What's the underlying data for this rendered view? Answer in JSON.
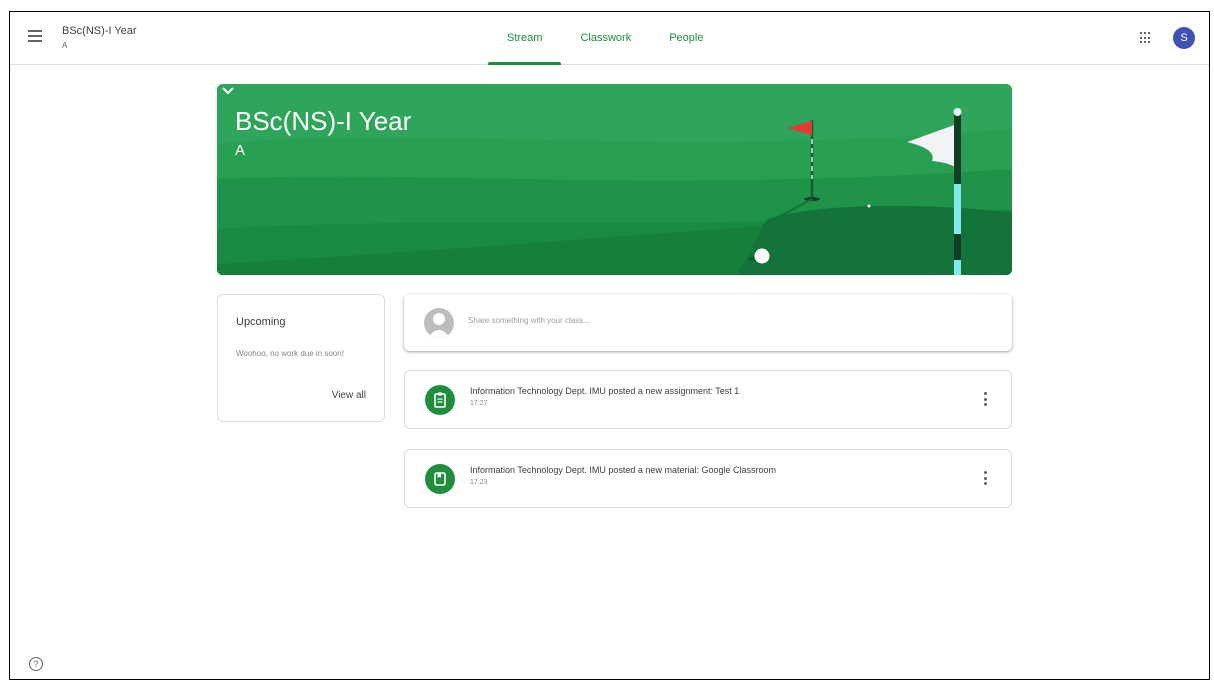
{
  "header": {
    "class_name": "BSc(NS)-I Year",
    "section": "A",
    "tabs": [
      {
        "label": "Stream"
      },
      {
        "label": "Classwork"
      },
      {
        "label": "People"
      }
    ],
    "avatar_initial": "S"
  },
  "banner": {
    "title": "BSc(NS)-I Year",
    "section": "A"
  },
  "upcoming": {
    "title": "Upcoming",
    "message": "Woohoo, no work due in soon!",
    "view_all": "View all"
  },
  "share": {
    "placeholder": "Share something with your class..."
  },
  "posts": [
    {
      "text": "Information Technology Dept. IMU posted a new assignment: Test 1",
      "time": "17:27",
      "icon": "assignment-icon"
    },
    {
      "text": "Information Technology Dept. IMU posted a new material: Google Classroom",
      "time": "17:23",
      "icon": "material-icon"
    }
  ],
  "colors": {
    "brand_green": "#1e8e3e",
    "avatar_blue": "#3f51b5"
  },
  "help_icon": "?"
}
